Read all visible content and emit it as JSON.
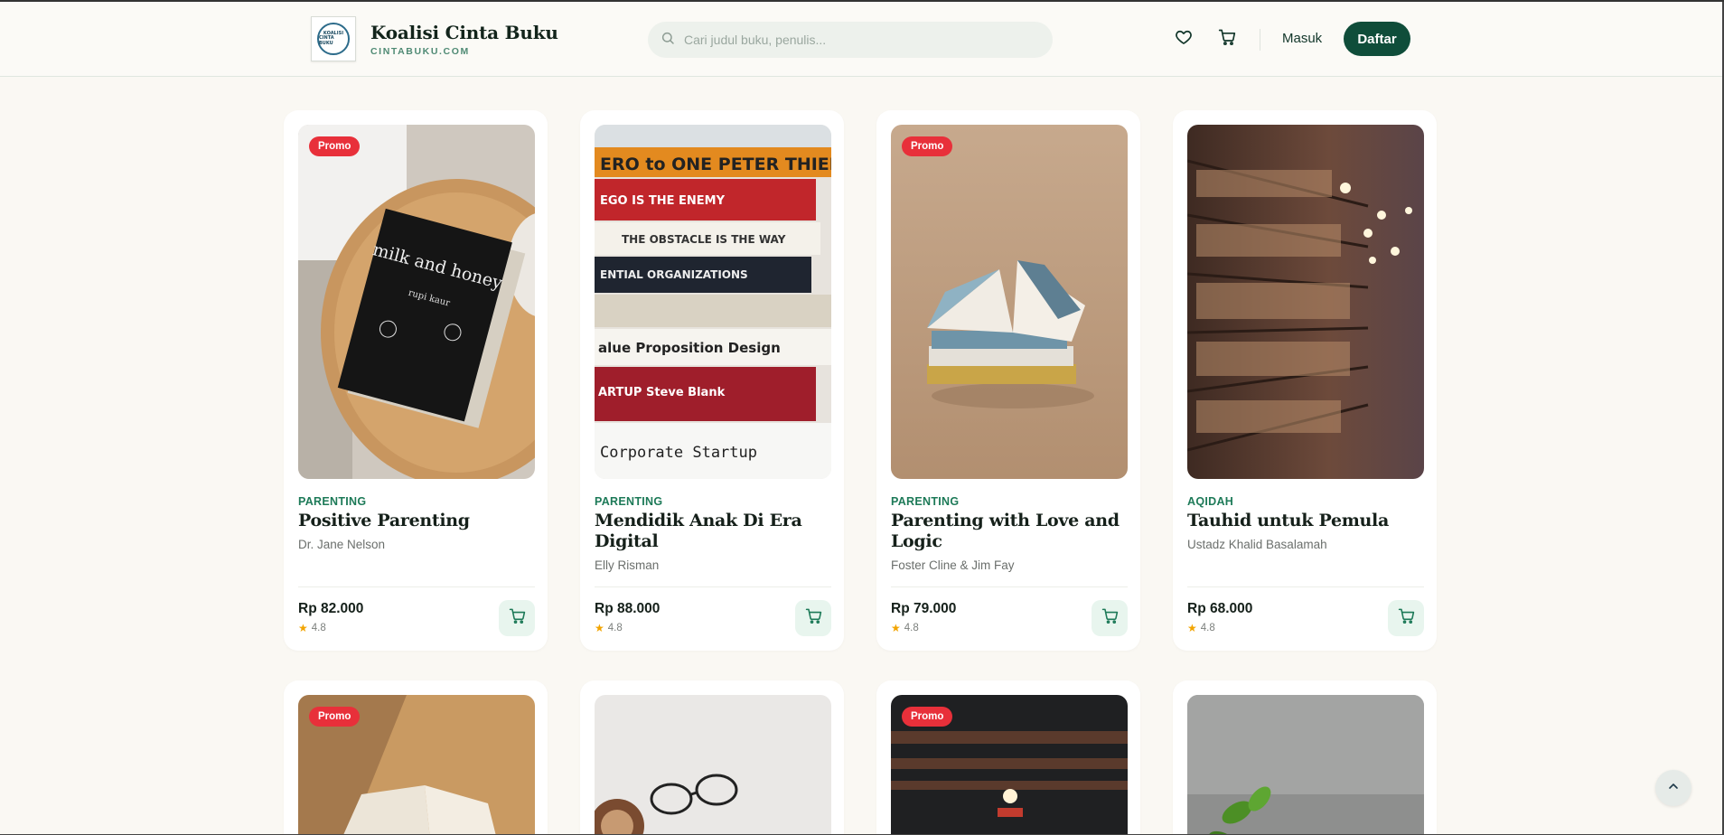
{
  "header": {
    "brand_name": "Koalisi Cinta Buku",
    "brand_domain": "CINTABUKU.COM",
    "logo_text_line1": "KOALISI",
    "logo_text_line2": "CINTA BUKU",
    "search_placeholder": "Cari judul buku, penulis...",
    "login_label": "Masuk",
    "register_label": "Daftar",
    "icons": [
      "heart-icon",
      "cart-icon",
      "search-icon"
    ]
  },
  "colors": {
    "primary": "#0f4d3a",
    "accent_green": "#1d7a58",
    "promo_red": "#e8303a",
    "background": "#faf8f3",
    "star": "#f2a400"
  },
  "books": [
    {
      "promo": "Promo",
      "category": "PARENTING",
      "title": "Positive Parenting",
      "author": "Dr. Jane Nelson",
      "price": "Rp 82.000",
      "rating": "4.8"
    },
    {
      "promo": "",
      "category": "PARENTING",
      "title": "Mendidik Anak Di Era Digital",
      "author": "Elly Risman",
      "price": "Rp 88.000",
      "rating": "4.8"
    },
    {
      "promo": "Promo",
      "category": "PARENTING",
      "title": "Parenting with Love and Logic",
      "author": "Foster Cline & Jim Fay",
      "price": "Rp 79.000",
      "rating": "4.8"
    },
    {
      "promo": "",
      "category": "AQIDAH",
      "title": "Tauhid untuk Pemula",
      "author": "Ustadz Khalid Basalamah",
      "price": "Rp 68.000",
      "rating": "4.8"
    }
  ],
  "books_row2": [
    {
      "promo": "Promo"
    },
    {
      "promo": ""
    },
    {
      "promo": "Promo"
    },
    {
      "promo": ""
    }
  ],
  "cover_texts": {
    "milk_title": "milk and honey",
    "milk_author": "rupi kaur",
    "stack_lines": [
      "ERO to ONE   PETER THIEL",
      "EGO IS THE ENEMY",
      "THE OBSTACLE IS THE WAY",
      "ENTIAL ORGANIZATIONS",
      "alue Proposition Design",
      "ARTUP  Steve Blank",
      "Corporate Startup"
    ]
  }
}
